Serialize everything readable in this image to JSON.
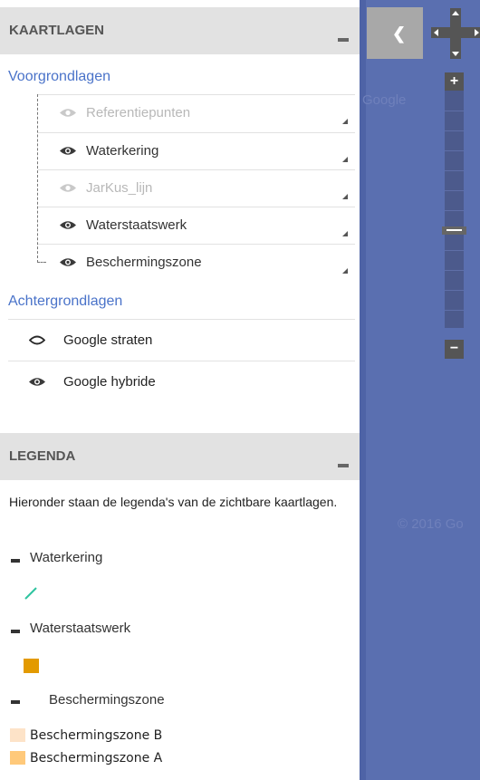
{
  "layers_panel": {
    "header": {
      "title": "KAARTLAGEN"
    },
    "foreground": {
      "title": "Voorgrondlagen",
      "items": [
        {
          "label": "Referentiepunten",
          "visible": false
        },
        {
          "label": "Waterkering",
          "visible": true
        },
        {
          "label": "JarKus_lijn",
          "visible": false
        },
        {
          "label": "Waterstaatswerk",
          "visible": true
        },
        {
          "label": "Beschermingszone",
          "visible": true
        }
      ]
    },
    "background": {
      "title": "Achtergrondlagen",
      "items": [
        {
          "label": "Google straten",
          "selected": false
        },
        {
          "label": "Google hybride",
          "selected": true
        }
      ]
    }
  },
  "legend_panel": {
    "header": {
      "title": "LEGENDA"
    },
    "intro": "Hieronder staan de legenda's van de zichtbare kaartlagen.",
    "groups": [
      {
        "label": "Waterkering",
        "symbol": "line",
        "color": "#2fc4a0"
      },
      {
        "label": "Waterstaatswerk",
        "symbol": "square",
        "color": "#e39a00"
      },
      {
        "label": "Beschermingszone",
        "items": [
          {
            "label": "Beschermingszone B",
            "color": "#fde3c8"
          },
          {
            "label": "Beschermingszone A",
            "color": "#ffc97a"
          }
        ]
      }
    ]
  },
  "map": {
    "watermarks": [
      "Google",
      "© 2016 Go"
    ],
    "zoom_in_label": "+",
    "zoom_out_label": "−",
    "colors": {
      "map": "#5a6fb0",
      "accent": "#4a73c9"
    }
  }
}
